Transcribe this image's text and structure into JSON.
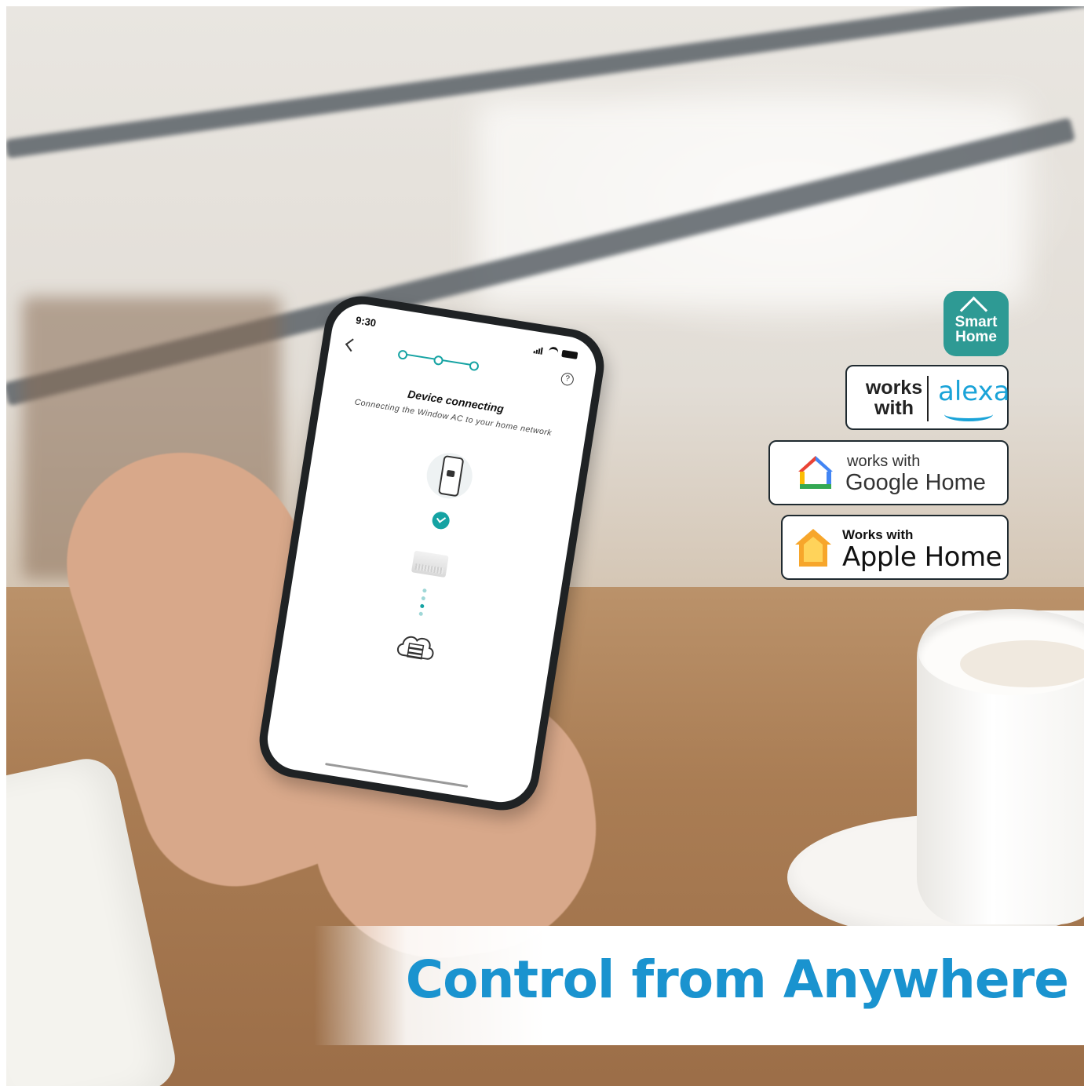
{
  "headline": "Control from Anywhere",
  "phone_screen": {
    "status_time": "9:30",
    "title": "Device connecting",
    "subtitle": "Connecting the Window AC to your home network",
    "help_glyph": "?",
    "step_count": 3,
    "accent": "#15a3a3"
  },
  "badges": {
    "smart_home": {
      "line1": "Smart",
      "line2": "Home",
      "color": "#2e9a94"
    },
    "alexa": {
      "works": "works",
      "with": "with",
      "brand": "alexa",
      "color": "#1aa3d8"
    },
    "google": {
      "works": "works with",
      "brand": "Google Home"
    },
    "apple": {
      "works": "Works with",
      "brand": "Apple Home"
    }
  },
  "colors": {
    "headline": "#1a93cf"
  },
  "icons": [
    "back-chevron-icon",
    "help-icon",
    "phone-icon",
    "check-icon",
    "air-conditioner-icon",
    "cloud-server-icon",
    "google-home-icon",
    "apple-home-icon",
    "smart-home-roof-icon",
    "alexa-smile-icon"
  ]
}
